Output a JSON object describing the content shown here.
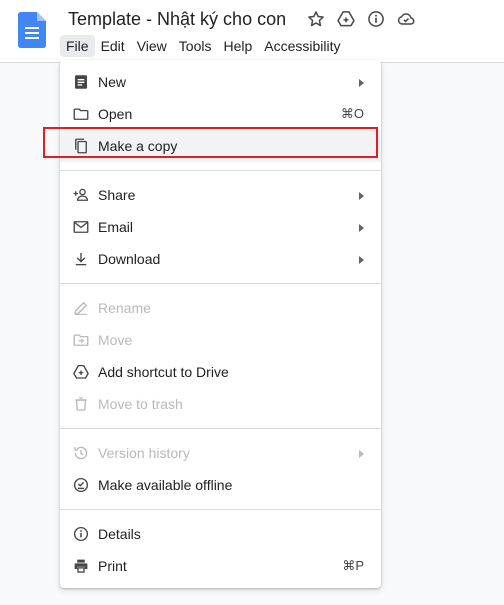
{
  "document": {
    "title": "Template - Nhật ký cho con"
  },
  "title_icons": [
    "star-icon",
    "move-to-drive-icon",
    "info-icon",
    "cloud-saved-icon"
  ],
  "menubar": [
    "File",
    "Edit",
    "View",
    "Tools",
    "Help",
    "Accessibility"
  ],
  "file_menu": {
    "new": {
      "label": "New",
      "icon": "document-icon",
      "submenu": true
    },
    "open": {
      "label": "Open",
      "icon": "folder-icon",
      "shortcut": "⌘O"
    },
    "make_copy": {
      "label": "Make a copy",
      "icon": "copy-icon"
    },
    "share": {
      "label": "Share",
      "icon": "person-add-icon",
      "submenu": true
    },
    "email": {
      "label": "Email",
      "icon": "email-icon",
      "submenu": true
    },
    "download": {
      "label": "Download",
      "icon": "download-icon",
      "submenu": true
    },
    "rename": {
      "label": "Rename",
      "icon": "pencil-icon",
      "disabled": true
    },
    "move": {
      "label": "Move",
      "icon": "move-icon",
      "disabled": true
    },
    "add_shortcut": {
      "label": "Add shortcut to Drive",
      "icon": "drive-shortcut-icon"
    },
    "trash": {
      "label": "Move to trash",
      "icon": "trash-icon",
      "disabled": true
    },
    "version_history": {
      "label": "Version history",
      "icon": "history-icon",
      "disabled": true,
      "submenu": true
    },
    "offline": {
      "label": "Make available offline",
      "icon": "offline-check-icon"
    },
    "details": {
      "label": "Details",
      "icon": "info-icon"
    },
    "print": {
      "label": "Print",
      "icon": "print-icon",
      "shortcut": "⌘P"
    }
  },
  "colors": {
    "highlight": "#e41e1e",
    "docs_blue": "#4285f4",
    "disabled_text": "#b7b9bb"
  }
}
